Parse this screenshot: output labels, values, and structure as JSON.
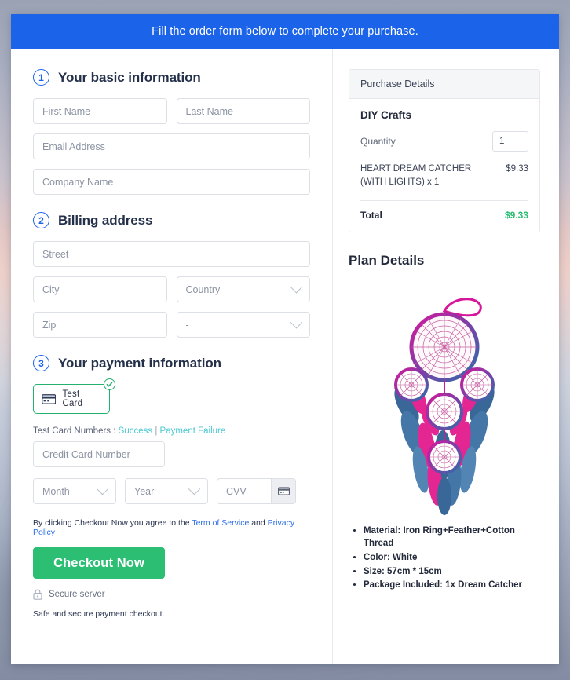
{
  "banner": {
    "text": "Fill the order form below to complete your purchase."
  },
  "sections": {
    "basic": {
      "number": "1",
      "title": "Your basic information",
      "fields": {
        "first_name": "First Name",
        "last_name": "Last Name",
        "email": "Email Address",
        "company": "Company Name"
      }
    },
    "billing": {
      "number": "2",
      "title": "Billing address",
      "fields": {
        "street": "Street",
        "city": "City",
        "country": "Country",
        "zip": "Zip",
        "state": "-"
      }
    },
    "payment": {
      "number": "3",
      "title": "Your payment information",
      "card_option_label": "Test  Card",
      "test_numbers_label": "Test Card Numbers :",
      "test_success_link": "Success",
      "test_separator": "|",
      "test_failure_link": "Payment Failure",
      "credit_card_number": "Credit Card Number",
      "month": "Month",
      "year": "Year",
      "cvv": "CVV",
      "terms_prefix": "By clicking Checkout Now you agree to the",
      "terms_link": "Term of Service",
      "terms_and": "and",
      "privacy_link": "Privacy Policy",
      "checkout_button": "Checkout Now",
      "secure_server": "Secure server",
      "safe_note": "Safe and secure payment checkout."
    }
  },
  "purchase": {
    "header": "Purchase Details",
    "plan_name": "DIY Crafts",
    "quantity_label": "Quantity",
    "quantity_value": "1",
    "item_name": "HEART DREAM CATCHER (WITH LIGHTS) x 1",
    "item_price": "$9.33",
    "total_label": "Total",
    "total_value": "$9.33"
  },
  "plan_details": {
    "heading": "Plan Details",
    "product_image_alt": "heart-dream-catcher-product-image",
    "specs": [
      "Material: Iron Ring+Feather+Cotton Thread",
      "Color: White",
      "Size: 57cm * 15cm",
      "Package Included: 1x Dream Catcher"
    ]
  },
  "colors": {
    "banner_blue": "#1b63e8",
    "accent_green": "#2cbe73",
    "card_border_green": "#23b26d",
    "link_blue": "#2f6fe4",
    "link_teal": "#4bc8d2"
  }
}
